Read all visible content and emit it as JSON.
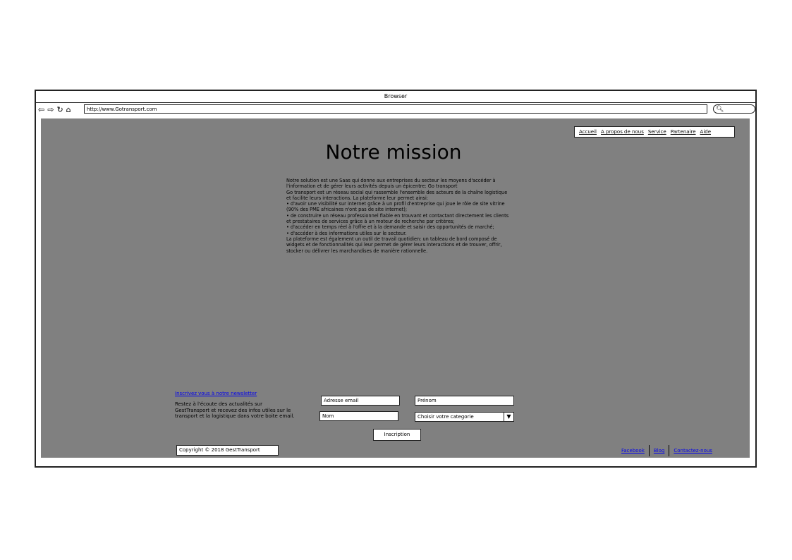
{
  "browser": {
    "title": "Browser",
    "url": "http://www.Gotransport.com",
    "nav_icons": [
      "back-arrow",
      "forward-arrow",
      "reload",
      "home"
    ]
  },
  "menu": {
    "items": [
      "Accueil",
      "A propos de nous",
      "Service",
      "Partenaire",
      "Aide"
    ]
  },
  "main": {
    "title": "Notre mission",
    "body": "Notre solution est une Saas qui donne aux entreprises du secteur les moyens d'accéder à l'information et de gérer leurs activités depuis un épicentre: Go transport\nGo transport est un réseau social qui rassemble l'ensemble des acteurs de la chaîne logistique et facilite leurs interactions. La plateforme leur permet ainsi:\n   • d'avoir une visibilité sur internet grâce à un profil d'entreprise qui joue le rôle de site vitrine (90% des PME africaines n'ont pas de site internet);\n   • de construire un réseau professionnel fiable en trouvant et contactant directement les clients et prestataires de services grâce à un moteur de recherche par critères;\n   • d'accéder en temps réel à l'offre et à la demande et saisir des opportunités de marché;\n   • d'accéder à des informations utiles sur le secteur.\nLa plateforme est également un outil de travail quotidien: un tableau de bord composé de widgets et de fonctionnalités qui leur permet de gérer leurs interactions et de trouver, offrir, stocker ou délivrer les marchandises de manière rationnelle."
  },
  "newsletter": {
    "link": "Inscrivez vous à notre newsletter",
    "description": "Restez à l'écoute des actualités sur\nGestTransport et recevez des infos utiles sur le\ntransport et la logistique dans votre boite email.",
    "email_placeholder": "Adresse email",
    "prenom_placeholder": "Prénom",
    "nom_placeholder": "Nom",
    "category_selected": "Choisir votre categorie",
    "submit": "Inscription"
  },
  "footer": {
    "copyright": "Copyright © 2018 GestTransport",
    "links": [
      "Facebook",
      "Blog",
      "Contactez-nous"
    ]
  }
}
